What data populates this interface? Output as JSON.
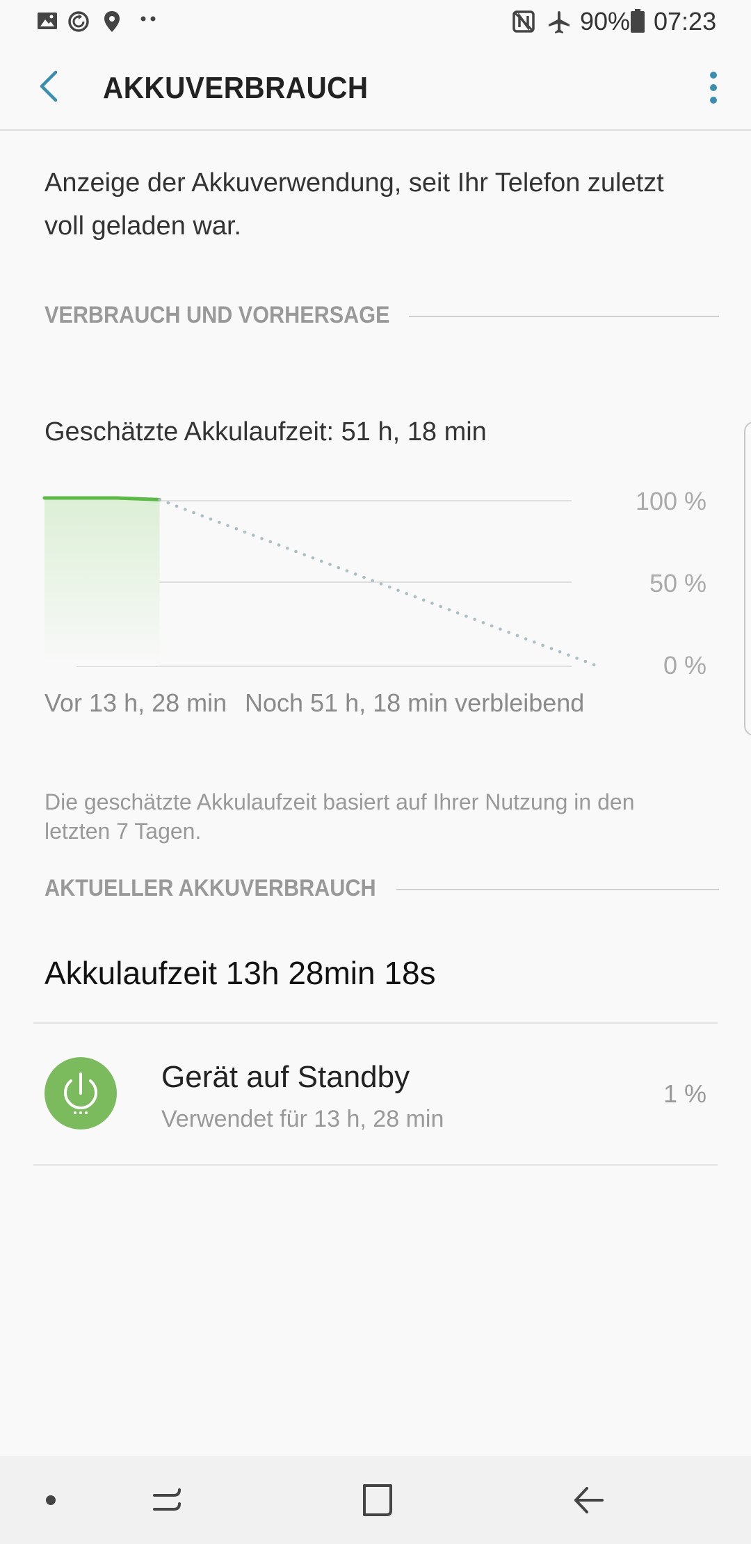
{
  "status_bar": {
    "battery_percent": "90%",
    "time": "07:23",
    "icons": [
      "gallery-icon",
      "sync-icon",
      "location-icon",
      "more-notifications-icon",
      "nfc-icon",
      "airplane-mode-icon",
      "battery-icon"
    ]
  },
  "app_bar": {
    "title": "AKKUVERBRAUCH",
    "back_icon": "back-arrow-icon",
    "more_icon": "more-vertical-icon"
  },
  "intro": "Anzeige der Akkuverwendung, seit Ihr Telefon zuletzt voll geladen war.",
  "usage_section": {
    "header": "VERBRAUCH UND VORHERSAGE",
    "estimate": "Geschätzte Akkulaufzeit: 51 h, 18 min",
    "x_label_left": "Vor 13 h, 28 min",
    "x_label_right": "Noch 51 h, 18 min verbleibend",
    "note": "Die geschätzte Akkulaufzeit basiert auf Ihrer Nutzung in den letzten 7 Tagen."
  },
  "chart_data": {
    "type": "line",
    "y_ticks": [
      "100 %",
      "50 %",
      "0 %"
    ],
    "ylim": [
      0,
      100
    ],
    "xlim": [
      -13.47,
      51.3
    ],
    "series": [
      {
        "style": "solid",
        "color": "#5cb947",
        "x": [
          -13.47,
          -5,
          0
        ],
        "y": [
          100,
          100,
          99
        ]
      },
      {
        "style": "dotted",
        "color": "#a9bfc3",
        "x": [
          0,
          51.3
        ],
        "y": [
          99,
          0
        ]
      }
    ],
    "grid": true
  },
  "current_section": {
    "header": "AKTUELLER AKKUVERBRAUCH",
    "battery_time": "Akkulaufzeit 13h 28min 18s",
    "items": [
      {
        "icon": "power-icon",
        "title": "Gerät auf Standby",
        "subtitle": "Verwendet für 13 h, 28 min",
        "percent": "1 %"
      }
    ]
  },
  "colors": {
    "accent": "#3a8fb0",
    "chart_green": "#5cb947",
    "standby_icon_bg": "#7bbb5e"
  },
  "nav_bar": {
    "icons": [
      "dot-icon",
      "recent-apps-icon",
      "home-icon",
      "back-icon"
    ]
  }
}
